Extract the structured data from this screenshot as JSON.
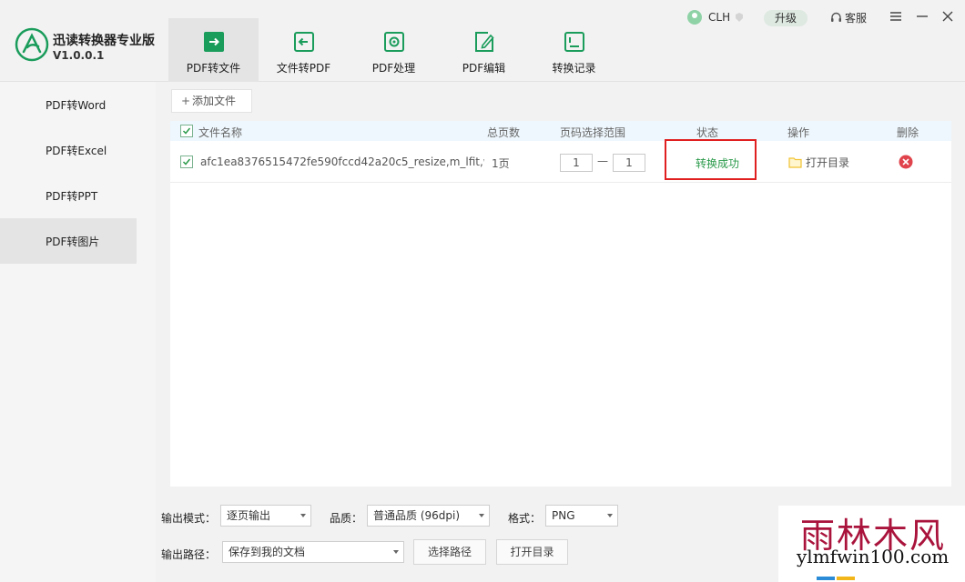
{
  "app": {
    "name": "迅读转换器专业版",
    "version": "V1.0.0.1"
  },
  "tabs": [
    {
      "label": "PDF转文件",
      "icon": "pdf-to-file-icon"
    },
    {
      "label": "文件转PDF",
      "icon": "file-to-pdf-icon"
    },
    {
      "label": "PDF处理",
      "icon": "pdf-process-icon"
    },
    {
      "label": "PDF编辑",
      "icon": "pdf-edit-icon"
    },
    {
      "label": "转换记录",
      "icon": "history-icon"
    }
  ],
  "topbar": {
    "username": "CLH",
    "upgrade_label": "升级",
    "service_label": "客服"
  },
  "sidebar": {
    "items": [
      {
        "label": "PDF转Word"
      },
      {
        "label": "PDF转Excel"
      },
      {
        "label": "PDF转PPT"
      },
      {
        "label": "PDF转图片"
      }
    ]
  },
  "main": {
    "add_file_label": "添加文件",
    "table": {
      "headers": {
        "filename": "文件名称",
        "pages": "总页数",
        "range": "页码选择范围",
        "status": "状态",
        "operation": "操作",
        "delete": "删除"
      },
      "rows": [
        {
          "filename": "afc1ea8376515472fe590fccd42a20c5_resize,m_lfit,w_...",
          "pages": "1页",
          "range_from": "1",
          "range_to": "1",
          "status": "转换成功",
          "operation": "打开目录"
        }
      ]
    }
  },
  "output": {
    "mode_label": "输出模式：",
    "mode_value": "逐页输出",
    "quality_label": "品质：",
    "quality_value": "普通品质 (96dpi)",
    "format_label": "格式：",
    "format_value": "PNG",
    "path_label": "输出路径：",
    "path_value": "保存到我的文档",
    "choose_path_label": "选择路径",
    "open_dir_label": "打开目录"
  },
  "watermark": {
    "cn": "雨林木风",
    "en": "ylmfwin100.com"
  },
  "colors": {
    "accent": "#1a9c5b",
    "status_success": "#2a9a4a",
    "highlight_box": "#e02020",
    "delete": "#e0434b",
    "folder": "#f1c232"
  }
}
